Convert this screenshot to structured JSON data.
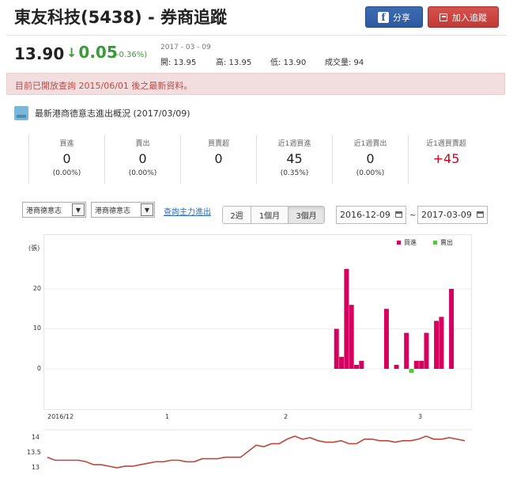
{
  "header": {
    "title": "東友科技(5438) - 券商追蹤",
    "share_label": "分享",
    "follow_label": "加入追蹤"
  },
  "quote": {
    "price": "13.90",
    "change": "0.05",
    "change_pct": "(-0.36%)",
    "date": "2017 - 03 - 09",
    "open": "開: 13.95",
    "high": "高: 13.95",
    "low": "低: 13.90",
    "volume": "成交量: 94"
  },
  "notice": "目前已開放查詢 2015/06/01 後之最新資料。",
  "section": {
    "title": "最新港商德意志進出概況 (2017/03/09)"
  },
  "stats": [
    {
      "label": "買進",
      "value": "0",
      "pct": "(0.00%)"
    },
    {
      "label": "賣出",
      "value": "0",
      "pct": "(0.00%)"
    },
    {
      "label": "買賣超",
      "value": "0",
      "pct": ""
    },
    {
      "label": "近1週買進",
      "value": "45",
      "pct": "(0.35%)"
    },
    {
      "label": "近1週賣出",
      "value": "0",
      "pct": "(0.00%)"
    },
    {
      "label": "近1週買賣超",
      "value": "+45",
      "pct": ""
    }
  ],
  "controls": {
    "broker_select_1": "港商德意志",
    "broker_select_2": "港商德意志",
    "query_link": "查詢主力進出",
    "period_tabs": [
      "2週",
      "1個月",
      "3個月"
    ],
    "active_tab": "3個月",
    "date_from": "2016-12-09",
    "date_to": "2017-03-09",
    "tilde": "~"
  },
  "colors": {
    "buy": "#d6005f",
    "sell": "#5cc04a",
    "price_line": "#c0463a",
    "red_value": "#d0021b",
    "down_green": "#3a9a3a"
  },
  "chart_data": {
    "type": "bar",
    "unit_label": "(張)",
    "legend": [
      "買進",
      "賣出"
    ],
    "legend_position": "top-right",
    "yticks": [
      "20",
      "10",
      "0"
    ],
    "ylim": [
      -10,
      30
    ],
    "xtick_labels": [
      "2016/12",
      "1",
      "2",
      "3"
    ],
    "series": [
      {
        "name": "買進",
        "points": [
          {
            "day": 59,
            "value": 10
          },
          {
            "day": 60,
            "value": 3
          },
          {
            "day": 61,
            "value": 25
          },
          {
            "day": 62,
            "value": 16
          },
          {
            "day": 63,
            "value": 1
          },
          {
            "day": 64,
            "value": 2
          },
          {
            "day": 69,
            "value": 15
          },
          {
            "day": 71,
            "value": 1
          },
          {
            "day": 73,
            "value": 9
          },
          {
            "day": 75,
            "value": 2
          },
          {
            "day": 76,
            "value": 2
          },
          {
            "day": 77,
            "value": 9
          },
          {
            "day": 79,
            "value": 12
          },
          {
            "day": 80,
            "value": 13
          },
          {
            "day": 82,
            "value": 20
          }
        ]
      },
      {
        "name": "賣出",
        "points": [
          {
            "day": 74,
            "value": -1
          }
        ]
      }
    ],
    "price_chart": {
      "type": "line",
      "yticks": [
        "14",
        "13.5",
        "13"
      ],
      "ylim": [
        12.9,
        14.2
      ],
      "values": [
        13.35,
        13.25,
        13.25,
        13.25,
        13.25,
        13.2,
        13.1,
        13.1,
        13.05,
        13.0,
        13.05,
        13.05,
        13.1,
        13.15,
        13.2,
        13.2,
        13.25,
        13.25,
        13.2,
        13.2,
        13.3,
        13.3,
        13.3,
        13.35,
        13.35,
        13.35,
        13.55,
        13.75,
        13.7,
        13.8,
        13.8,
        13.95,
        14.05,
        13.95,
        14.0,
        13.9,
        13.85,
        13.85,
        13.9,
        13.8,
        13.8,
        13.95,
        13.95,
        13.9,
        13.9,
        13.85,
        13.9,
        13.9,
        13.95,
        14.05,
        13.95,
        13.95,
        14.0,
        13.95,
        13.9
      ]
    }
  }
}
